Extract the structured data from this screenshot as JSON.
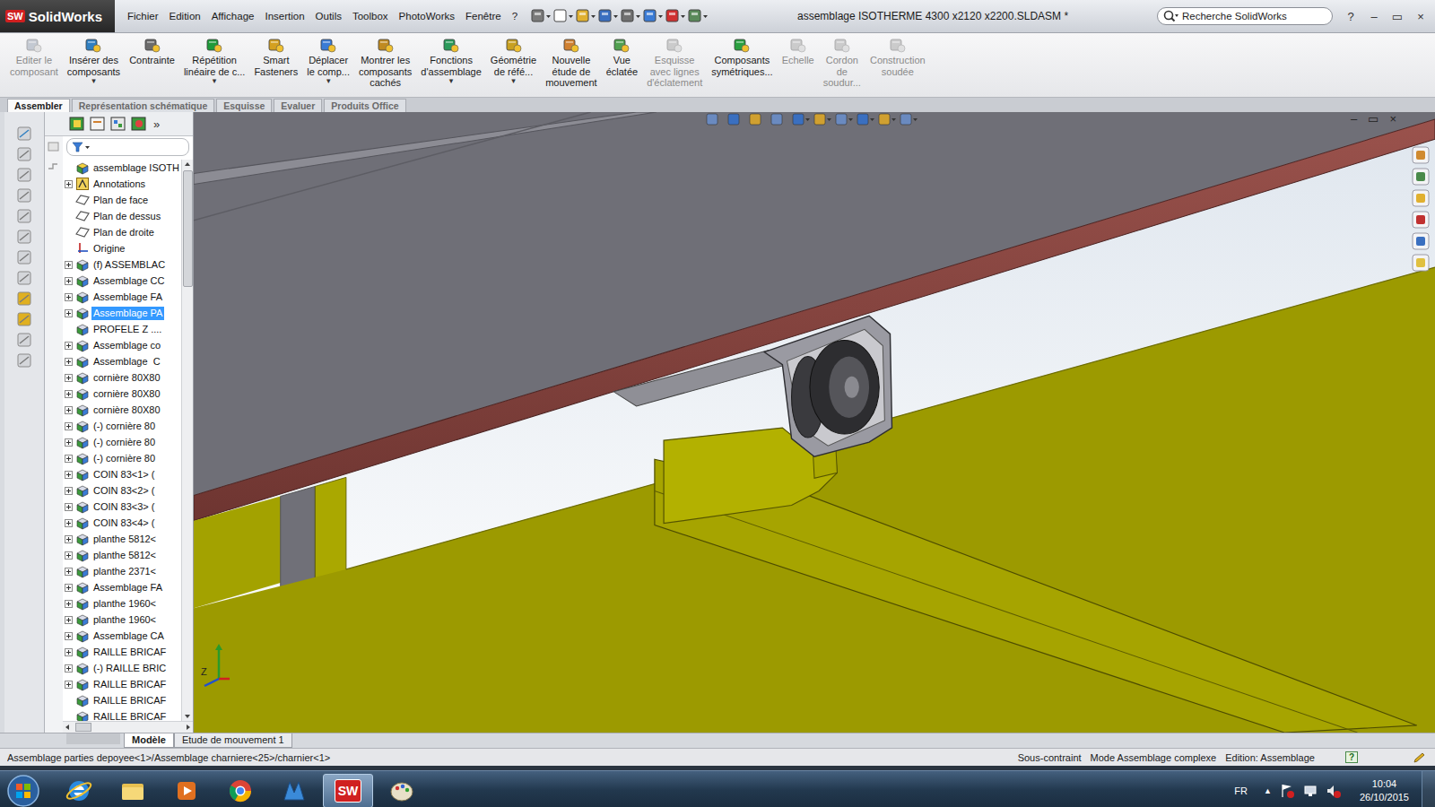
{
  "app": {
    "logo_badge": "SW",
    "logo": "SolidWorks"
  },
  "menu": [
    "Fichier",
    "Edition",
    "Affichage",
    "Insertion",
    "Outils",
    "Toolbox",
    "PhotoWorks",
    "Fenêtre",
    "?"
  ],
  "window": {
    "title": "assemblage ISOTHERME 4300 x2120 x2200.SLDASM *",
    "controls": [
      "?",
      "–",
      "▭",
      "×"
    ]
  },
  "search": {
    "placeholder": "Recherche SolidWorks"
  },
  "dropdown_glyph": "▾",
  "commands": [
    {
      "label": "Editer le\ncomposant",
      "disabled": true,
      "dropdown": false
    },
    {
      "label": "Insérer des\ncomposants",
      "disabled": false,
      "dropdown": true
    },
    {
      "label": "Contrainte",
      "disabled": false,
      "dropdown": false
    },
    {
      "label": "Répétition\nlinéaire de c...",
      "disabled": false,
      "dropdown": true
    },
    {
      "label": "Smart\nFasteners",
      "disabled": false,
      "dropdown": false
    },
    {
      "label": "Déplacer\nle comp...",
      "disabled": false,
      "dropdown": true
    },
    {
      "label": "Montrer les\ncomposants\ncachés",
      "disabled": false,
      "dropdown": false
    },
    {
      "label": "Fonctions\nd'assemblage",
      "disabled": false,
      "dropdown": true
    },
    {
      "label": "Géométrie\nde réfé...",
      "disabled": false,
      "dropdown": true
    },
    {
      "label": "Nouvelle\nétude de\nmouvement",
      "disabled": false,
      "dropdown": false
    },
    {
      "label": "Vue\néclatée",
      "disabled": false,
      "dropdown": false
    },
    {
      "label": "Esquisse\navec lignes\nd'éclatement",
      "disabled": true,
      "dropdown": false
    },
    {
      "label": "Composants\nsymétriques...",
      "disabled": false,
      "dropdown": false
    },
    {
      "label": "Echelle",
      "disabled": true,
      "dropdown": false
    },
    {
      "label": "Cordon\nde\nsoudur...",
      "disabled": true,
      "dropdown": false
    },
    {
      "label": "Construction\nsoudée",
      "disabled": true,
      "dropdown": false
    }
  ],
  "tabs": [
    {
      "label": "Assembler",
      "selected": true
    },
    {
      "label": "Représentation schématique",
      "selected": false
    },
    {
      "label": "Esquisse",
      "selected": false
    },
    {
      "label": "Evaluer",
      "selected": false
    },
    {
      "label": "Produits Office",
      "selected": false
    }
  ],
  "feature_tree": {
    "more": "»",
    "items": [
      {
        "label": "assemblage ISOTH",
        "kind": "root",
        "expandable": false,
        "selected": false
      },
      {
        "label": "Annotations",
        "kind": "annotations",
        "expandable": true,
        "selected": false
      },
      {
        "label": "Plan de face",
        "kind": "plane",
        "expandable": false,
        "selected": false
      },
      {
        "label": "Plan de dessus",
        "kind": "plane",
        "expandable": false,
        "selected": false
      },
      {
        "label": "Plan de droite",
        "kind": "plane",
        "expandable": false,
        "selected": false
      },
      {
        "label": "Origine",
        "kind": "origin",
        "expandable": false,
        "selected": false
      },
      {
        "label": "(f) ASSEMBLAC",
        "kind": "assembly",
        "expandable": true,
        "selected": false
      },
      {
        "label": "Assemblage CC",
        "kind": "assembly",
        "expandable": true,
        "selected": false
      },
      {
        "label": "Assemblage FA",
        "kind": "assembly",
        "expandable": true,
        "selected": false
      },
      {
        "label": "Assemblage PA",
        "kind": "assembly",
        "expandable": true,
        "selected": true
      },
      {
        "label": "PROFELE Z ....",
        "kind": "assembly",
        "expandable": false,
        "selected": false
      },
      {
        "label": "Assemblage co",
        "kind": "assembly",
        "expandable": true,
        "selected": false
      },
      {
        "label": "Assemblage  C",
        "kind": "assembly",
        "expandable": true,
        "selected": false
      },
      {
        "label": "cornière 80X80",
        "kind": "assembly",
        "expandable": true,
        "selected": false
      },
      {
        "label": "cornière 80X80",
        "kind": "assembly",
        "expandable": true,
        "selected": false
      },
      {
        "label": "cornière 80X80",
        "kind": "assembly",
        "expandable": true,
        "selected": false
      },
      {
        "label": "(-) cornière 80",
        "kind": "assembly",
        "expandable": true,
        "selected": false
      },
      {
        "label": "(-) cornière 80",
        "kind": "assembly",
        "expandable": true,
        "selected": false
      },
      {
        "label": "(-) cornière 80",
        "kind": "assembly",
        "expandable": true,
        "selected": false
      },
      {
        "label": "COIN 83<1> (",
        "kind": "assembly",
        "expandable": true,
        "selected": false
      },
      {
        "label": "COIN 83<2> (",
        "kind": "assembly",
        "expandable": true,
        "selected": false
      },
      {
        "label": "COIN 83<3> (",
        "kind": "assembly",
        "expandable": true,
        "selected": false
      },
      {
        "label": "COIN 83<4> (",
        "kind": "assembly",
        "expandable": true,
        "selected": false
      },
      {
        "label": "planthe 5812<",
        "kind": "assembly",
        "expandable": true,
        "selected": false
      },
      {
        "label": "planthe 5812<",
        "kind": "assembly",
        "expandable": true,
        "selected": false
      },
      {
        "label": "planthe 2371<",
        "kind": "assembly",
        "expandable": true,
        "selected": false
      },
      {
        "label": "Assemblage FA",
        "kind": "assembly",
        "expandable": true,
        "selected": false
      },
      {
        "label": "planthe 1960<",
        "kind": "assembly",
        "expandable": true,
        "selected": false
      },
      {
        "label": "planthe 1960<",
        "kind": "assembly",
        "expandable": true,
        "selected": false
      },
      {
        "label": "Assemblage CA",
        "kind": "assembly",
        "expandable": true,
        "selected": false
      },
      {
        "label": "RAILLE BRICAF",
        "kind": "assembly",
        "expandable": true,
        "selected": false
      },
      {
        "label": "(-) RAILLE BRIC",
        "kind": "assembly",
        "expandable": true,
        "selected": false
      },
      {
        "label": "RAILLE BRICAF",
        "kind": "assembly",
        "expandable": true,
        "selected": false
      },
      {
        "label": "RAILLE BRICAF",
        "kind": "assembly",
        "expandable": false,
        "selected": false
      },
      {
        "label": "RAILLE BRICAF",
        "kind": "assembly",
        "expandable": false,
        "selected": false
      }
    ]
  },
  "model_tabs": [
    {
      "label": "Modèle",
      "selected": true
    },
    {
      "label": "Etude de mouvement 1",
      "selected": false
    }
  ],
  "graphics": {
    "window_controls": [
      "–",
      "▭",
      "×"
    ],
    "triad": [
      "Z"
    ]
  },
  "status_bar": {
    "path": "Assemblage parties depoyee<1>/Assemblage charniere<25>/charnier<1>",
    "items": [
      "Sous-contraint",
      "Mode Assemblage complexe",
      "Edition: Assemblage"
    ],
    "help": "?"
  },
  "taskbar": {
    "apps": [
      {
        "kind": "ie",
        "active": false
      },
      {
        "kind": "explorer",
        "active": false
      },
      {
        "kind": "media",
        "active": false
      },
      {
        "kind": "chrome",
        "active": false
      },
      {
        "kind": "mail",
        "active": false
      },
      {
        "kind": "solidworks",
        "active": true,
        "label": "SW"
      },
      {
        "kind": "paint",
        "active": false
      }
    ],
    "language": "FR",
    "tray_arrow": "▲",
    "time": "10:04",
    "date": "26/10/2015"
  }
}
